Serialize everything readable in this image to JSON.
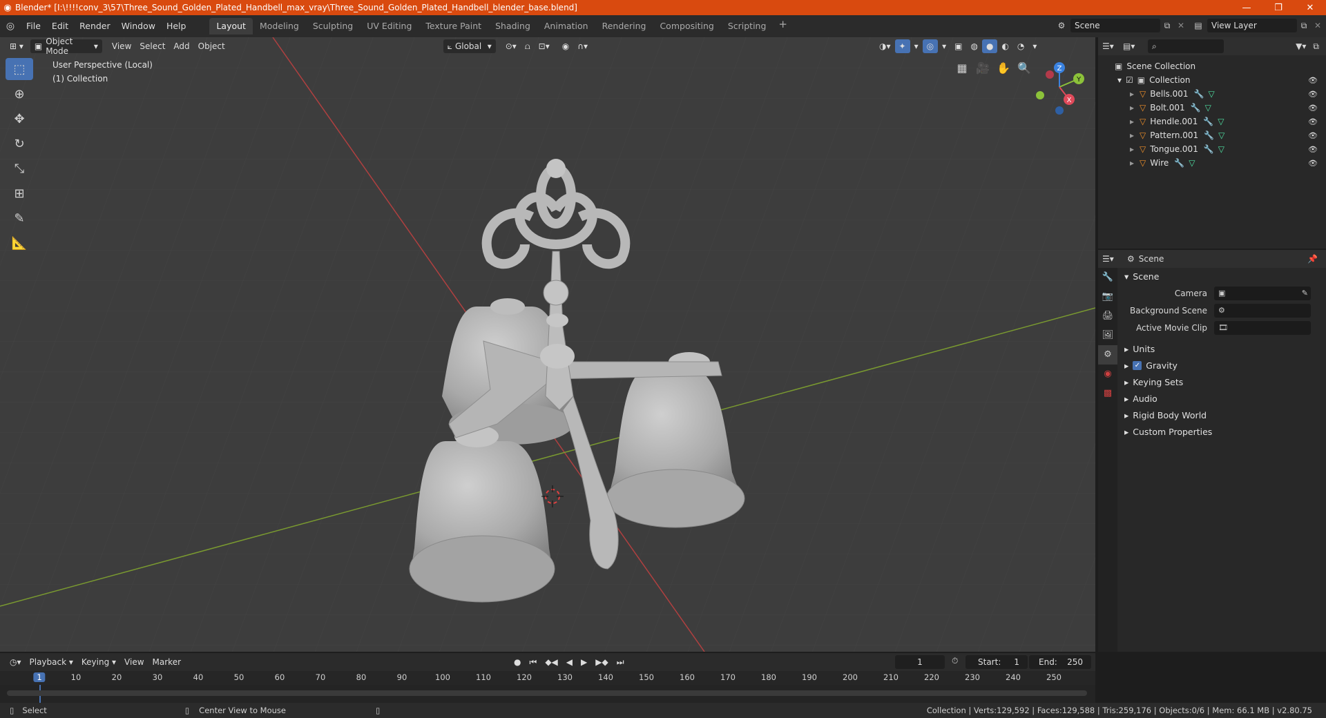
{
  "window": {
    "title": "Blender* [I:\\!!!!conv_3\\57\\Three_Sound_Golden_Plated_Handbell_max_vray\\Three_Sound_Golden_Plated_Handbell_blender_base.blend]",
    "minimize": "—",
    "maximize": "❐",
    "close": "✕"
  },
  "menu": {
    "items": [
      "File",
      "Edit",
      "Render",
      "Window",
      "Help"
    ],
    "workspaces": [
      "Layout",
      "Modeling",
      "Sculpting",
      "UV Editing",
      "Texture Paint",
      "Shading",
      "Animation",
      "Rendering",
      "Compositing",
      "Scripting"
    ],
    "active_workspace": "Layout",
    "scene": "Scene",
    "view_layer": "View Layer"
  },
  "viewport": {
    "mode": "Object Mode",
    "header_menus": [
      "View",
      "Select",
      "Add",
      "Object"
    ],
    "orientation": "Global",
    "info_line1": "User Perspective (Local)",
    "info_line2": "(1) Collection",
    "gizmo": {
      "x": "X",
      "y": "Y",
      "z": "Z"
    }
  },
  "outliner": {
    "root": "Scene Collection",
    "collection": "Collection",
    "objects": [
      "Bells.001",
      "Bolt.001",
      "Hendle.001",
      "Pattern.001",
      "Tongue.001",
      "Wire"
    ]
  },
  "properties": {
    "header": "Scene",
    "panel": "Scene",
    "rows": [
      {
        "label": "Camera"
      },
      {
        "label": "Background Scene"
      },
      {
        "label": "Active Movie Clip"
      }
    ],
    "sections": [
      "Units",
      "Gravity",
      "Keying Sets",
      "Audio",
      "Rigid Body World",
      "Custom Properties"
    ]
  },
  "timeline": {
    "menus": [
      "Playback",
      "Keying",
      "View",
      "Marker"
    ],
    "current_frame": "1",
    "start_label": "Start:",
    "start": "1",
    "end_label": "End:",
    "end": "250",
    "ticks": [
      "1",
      "10",
      "20",
      "30",
      "40",
      "50",
      "60",
      "70",
      "80",
      "90",
      "100",
      "110",
      "120",
      "130",
      "140",
      "150",
      "160",
      "170",
      "180",
      "190",
      "200",
      "210",
      "220",
      "230",
      "240",
      "250"
    ]
  },
  "status": {
    "left_hint": "Select",
    "middle_hint": "Center View to Mouse",
    "right": "Collection | Verts:129,592 | Faces:129,588 | Tris:259,176 | Objects:0/6 | Mem: 66.1 MB | v2.80.75"
  }
}
